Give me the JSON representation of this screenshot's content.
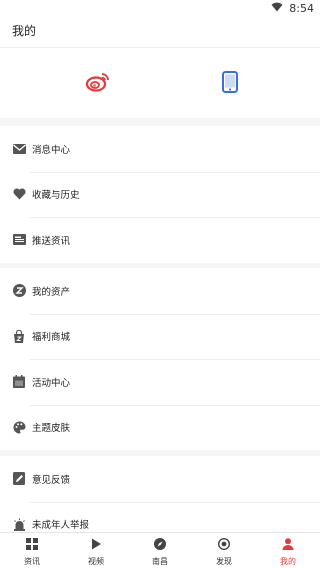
{
  "status": {
    "time": "8:54"
  },
  "header": {
    "title": "我的"
  },
  "login": {
    "weibo_icon": "weibo-icon",
    "phone_icon": "phone-icon"
  },
  "groups": [
    {
      "items": [
        {
          "label": "消息中心",
          "icon": "mail-icon"
        },
        {
          "label": "收藏与历史",
          "icon": "heart-icon"
        },
        {
          "label": "推送资讯",
          "icon": "push-icon"
        }
      ]
    },
    {
      "items": [
        {
          "label": "我的资产",
          "icon": "assets-icon"
        },
        {
          "label": "福利商城",
          "icon": "shop-bag-icon"
        },
        {
          "label": "活动中心",
          "icon": "calendar-icon"
        },
        {
          "label": "主题皮肤",
          "icon": "palette-icon"
        }
      ]
    },
    {
      "items": [
        {
          "label": "意见反馈",
          "icon": "feedback-icon"
        },
        {
          "label": "未成年人举报",
          "icon": "alarm-icon"
        }
      ]
    }
  ],
  "tabbar": {
    "tabs": [
      {
        "label": "资讯",
        "icon": "grid-icon"
      },
      {
        "label": "视频",
        "icon": "play-icon"
      },
      {
        "label": "南昌",
        "icon": "compass-icon"
      },
      {
        "label": "发现",
        "icon": "target-icon"
      },
      {
        "label": "我的",
        "icon": "user-icon",
        "active": true
      }
    ]
  },
  "colors": {
    "accent": "#e53a3a",
    "phone_blue": "#3b6fd8",
    "icon_gray": "#555555"
  }
}
